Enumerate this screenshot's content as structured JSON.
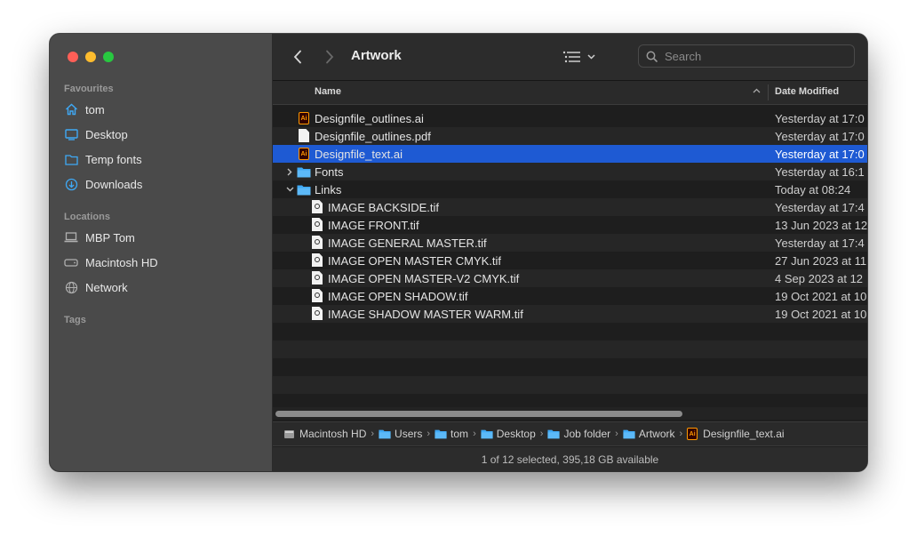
{
  "window": {
    "title": "Artwork"
  },
  "sidebar": {
    "favourites_header": "Favourites",
    "favourites": [
      {
        "label": "tom",
        "icon": "home-icon"
      },
      {
        "label": "Desktop",
        "icon": "desktop-icon"
      },
      {
        "label": "Temp fonts",
        "icon": "folder-icon"
      },
      {
        "label": "Downloads",
        "icon": "download-icon"
      }
    ],
    "locations_header": "Locations",
    "locations": [
      {
        "label": "MBP Tom",
        "icon": "laptop-icon"
      },
      {
        "label": "Macintosh HD",
        "icon": "disk-icon"
      },
      {
        "label": "Network",
        "icon": "globe-icon"
      }
    ],
    "tags_header": "Tags"
  },
  "toolbar": {
    "search_placeholder": "Search"
  },
  "columns": {
    "name": "Name",
    "date": "Date Modified"
  },
  "files": [
    {
      "name": "Designfile_outlines.ai",
      "date": "Yesterday at 17:0",
      "type": "ai"
    },
    {
      "name": "Designfile_outlines.pdf",
      "date": "Yesterday at 17:0",
      "type": "pdf"
    },
    {
      "name": "Designfile_text.ai",
      "date": "Yesterday at 17:0",
      "type": "ai",
      "selected": true
    },
    {
      "name": "Fonts",
      "date": "Yesterday at 16:1",
      "type": "folder",
      "disclosure": "collapsed"
    },
    {
      "name": "Links",
      "date": "Today at 08:24",
      "type": "folder",
      "disclosure": "expanded"
    },
    {
      "name": "IMAGE BACKSIDE.tif",
      "date": "Yesterday at 17:4",
      "type": "tif",
      "indent": 1
    },
    {
      "name": "IMAGE FRONT.tif",
      "date": "13 Jun 2023 at 12",
      "type": "tif",
      "indent": 1
    },
    {
      "name": "IMAGE GENERAL MASTER.tif",
      "date": "Yesterday at 17:4",
      "type": "tif",
      "indent": 1
    },
    {
      "name": "IMAGE OPEN MASTER CMYK.tif",
      "date": "27 Jun 2023 at 11",
      "type": "tif",
      "indent": 1
    },
    {
      "name": "IMAGE OPEN MASTER-V2 CMYK.tif",
      "date": "4 Sep 2023 at 12",
      "type": "tif",
      "indent": 1
    },
    {
      "name": "IMAGE OPEN SHADOW.tif",
      "date": "19 Oct 2021 at 10",
      "type": "tif",
      "indent": 1
    },
    {
      "name": "IMAGE SHADOW MASTER WARM.tif",
      "date": "19 Oct 2021 at 10",
      "type": "tif",
      "indent": 1
    }
  ],
  "pathbar": [
    {
      "label": "Macintosh HD",
      "icon": "disk-icon"
    },
    {
      "label": "Users",
      "icon": "folder-icon"
    },
    {
      "label": "tom",
      "icon": "folder-icon"
    },
    {
      "label": "Desktop",
      "icon": "folder-icon"
    },
    {
      "label": "Job folder",
      "icon": "folder-icon"
    },
    {
      "label": "Artwork",
      "icon": "folder-icon"
    },
    {
      "label": "Designfile_text.ai",
      "icon": "ai-file-icon"
    }
  ],
  "status": "1 of 12 selected, 395,18 GB available",
  "colors": {
    "selection": "#1e5ad3",
    "folder": "#3fa9f5",
    "ai_orange": "#ff9a00"
  }
}
